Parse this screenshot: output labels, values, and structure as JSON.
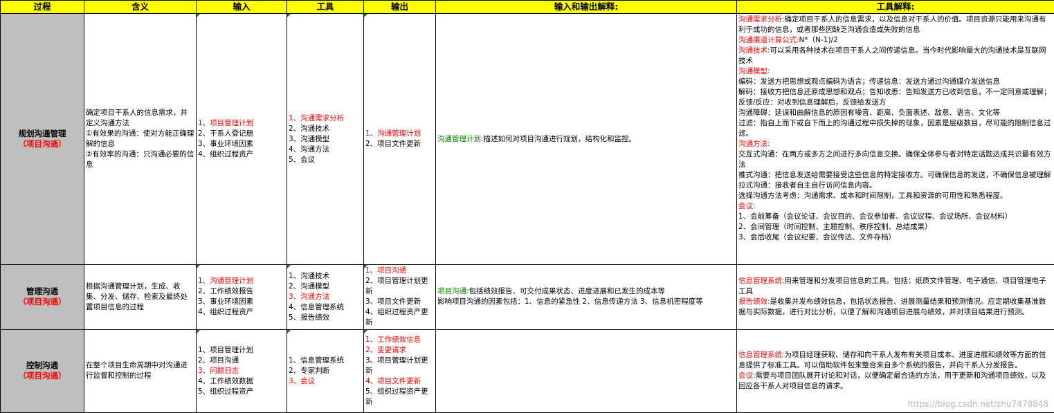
{
  "headers": {
    "process": "过程",
    "meaning": "含义",
    "input": "输入",
    "tools": "工具",
    "output": "输出",
    "io_explain": "输入和输出解释:",
    "tool_explain": "工具解释:"
  },
  "rows": [
    {
      "process": "规划沟通管理",
      "process_sub": "（项目沟通）",
      "meaning": [
        {
          "t": "确定项目干系人的信息需求，并定义沟通方法"
        },
        {
          "t": "①有效果的沟通：使对方能正确理解的信息"
        },
        {
          "t": "②有效率的沟通：只沟通必要的信息"
        }
      ],
      "input": [
        {
          "t": "1、项目管理计划",
          "c": "red"
        },
        {
          "t": "2、干系人登记册"
        },
        {
          "t": "3、事业环境因素"
        },
        {
          "t": "4、组织过程资产"
        }
      ],
      "tools": [
        {
          "t": "1、沟通需求分析",
          "c": "red"
        },
        {
          "t": "2、沟通技术"
        },
        {
          "t": "3、沟通模型"
        },
        {
          "t": "4、沟通方法"
        },
        {
          "t": "5、会议"
        }
      ],
      "output": [
        {
          "t": "1、沟通管理计划",
          "c": "red"
        },
        {
          "t": "2、项目文件更新"
        }
      ],
      "io_explain": [
        {
          "k": "沟通管理计划:",
          "kc": "green",
          "t": "描述如何对项目沟通进行规划，结构化和监控。"
        }
      ],
      "tool_explain": [
        {
          "k": "沟通需求分析:",
          "kc": "red",
          "t": "确定项目干系人的信息需求，以及信息对干系人的价值。项目资源只能用来沟通有利于成功的信息，或者那些因缺乏沟通会造成失败的信息"
        },
        {
          "k": "沟通渠道计算公式:",
          "kc": "red",
          "t": "N*（N-1)/2"
        },
        {
          "k": "沟通技术:",
          "kc": "red",
          "t": "可以采用各种技术在项目干系人之间传递信息。当今时代影响最大的沟通技术是互联网技术"
        },
        {
          "k": "沟通模型:",
          "kc": "red",
          "t": ""
        },
        {
          "t": "编码：发送方把思想或观点编码为语言；传递信息：发送方通过沟通媒介发送信息"
        },
        {
          "t": "解码：接收方把信息还原成思想和观点；告知收悉：告知发送方已收到信息，不一定同意或理解；反馈/反应：对收到信息理解后，反馈给发送方"
        },
        {
          "t": "沟通障碍：延误和曲解信息的原因有噪音、距离、负面表述、敌意、语言、文化等"
        },
        {
          "t": "过滤：指自上而下或自下而上的沟通过程中损失掉的现象，因素是层级数目，尽可能的限制信息过滤。"
        },
        {
          "k": "沟通方法:",
          "kc": "red",
          "t": ""
        },
        {
          "t": "交互式沟通：在两方或多方之间进行多向信息交换。确保全体参与者对特定话题达成共识最有效方法"
        },
        {
          "t": "推式沟通：把信息发送给需要接受这些信息的特定接收方。可确保信息的发送，不确保信息被理解"
        },
        {
          "t": "拉式沟通：接收者自主自行访问信息内容。"
        },
        {
          "t": "选择沟通方法考虑：沟通需求、成本和时间限制，工具和资源的可用性和熟悉程度。"
        },
        {
          "k": "会议:",
          "kc": "red",
          "t": ""
        },
        {
          "t": "1、会前筹备（会议论证、会议目的、会议参加者、会议议程、会议场所、会议材料）"
        },
        {
          "t": "2、会间管理（时间控制、主题控制、秩序控制、总结成果）"
        },
        {
          "t": "3、会后收尾（会议纪要、会议传达、文件存档）"
        }
      ]
    },
    {
      "process": "管理沟通",
      "process_sub": "（项目沟通）",
      "meaning": [
        {
          "t": "根据沟通管理计划，生成、收集、分发、储存、检索及最终处置项目信息的过程"
        }
      ],
      "input": [
        {
          "t": "1、沟通管理计划",
          "c": "red"
        },
        {
          "t": "2、工作绩效报告"
        },
        {
          "t": "3、事业环境因素"
        },
        {
          "t": "4、组织过程资产"
        }
      ],
      "tools": [
        {
          "t": "1、沟通技术"
        },
        {
          "t": "2、沟通模型"
        },
        {
          "t": "3、沟通方法",
          "c": "red"
        },
        {
          "t": "4、信息管理系统"
        },
        {
          "t": "5、报告绩效"
        }
      ],
      "output": [
        {
          "t": "1、项目沟通",
          "c": "red"
        },
        {
          "t": "2、项目管理计划更新"
        },
        {
          "t": "3、项目文件更新"
        },
        {
          "t": "4、组织过程资产更新"
        }
      ],
      "io_explain": [
        {
          "k": "项目沟通:",
          "kc": "green",
          "t": "包括绩效报告、可交付成果状态、进度进展和已发生的成本等"
        },
        {
          "t": "影响项目沟通的因素包括：1、信息的紧急性 2、信息传递方法 3、信息机密程度等"
        }
      ],
      "tool_explain": [
        {
          "k": "信息管理系统:",
          "kc": "red",
          "t": "用来管理和分发项目信息的工具。包括：纸质文件管理、电子通信、项目管理电子工具"
        },
        {
          "k": "报告绩效:",
          "kc": "red",
          "t": "是收集并发布绩效信息，包括状态报告、进展测量结果和预测情况。应定期收集基准数据与实际数据，进行对比分析，以便了解和沟通项目进展与绩效，并对项目结果进行预测。"
        }
      ]
    },
    {
      "process": "控制沟通",
      "process_sub": "（项目沟通）",
      "meaning": [
        {
          "t": "在整个项目生命周期中对沟通进行监督和控制的过程"
        }
      ],
      "input": [
        {
          "t": "1、项目管理计划"
        },
        {
          "t": "2、项目沟通"
        },
        {
          "t": "3、问题日志",
          "c": "red"
        },
        {
          "t": "4、工作绩效数据"
        },
        {
          "t": "5、组织过程资产"
        }
      ],
      "tools": [
        {
          "t": "1、信息管理系统"
        },
        {
          "t": "2、专家判断"
        },
        {
          "t": "3、会议",
          "c": "red"
        }
      ],
      "output": [
        {
          "t": "1、工作绩效信息",
          "c": "red"
        },
        {
          "t": "2、变更请求",
          "c": "red"
        },
        {
          "t": "3、项目管理计划更新"
        },
        {
          "t": "4、项目文件更新",
          "c": "red"
        },
        {
          "t": "5、组织过程资产更新"
        }
      ],
      "io_explain": [],
      "tool_explain": [
        {
          "k": "信息管理系统:",
          "kc": "red",
          "t": "为项目经理获取、储存和向干系人发布有关项目成本、进度进展和绩效等方面的信息提供了标准工具。可以借助软件包来整合来自多个系统的报告，并向干系人分发报告。"
        },
        {
          "k": "会议:",
          "kc": "red",
          "t": "需要与项目团队展开讨论和对话，以便确定最合适的方法，用于更新和沟通项目绩效，以及回应各干系人对项目信息的请求。"
        }
      ]
    }
  ],
  "watermark": "https://blog.csdn.net/zhu7478848"
}
